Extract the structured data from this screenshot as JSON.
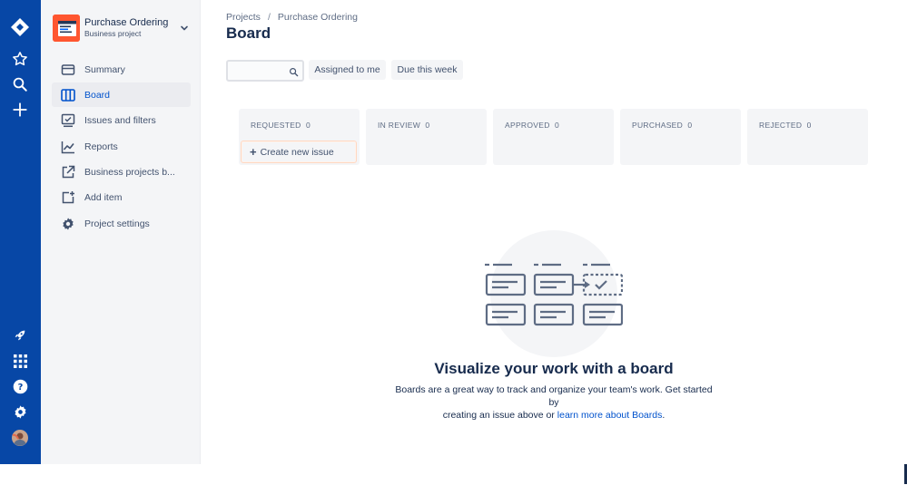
{
  "global_nav": {
    "icons": [
      "jira-logo-icon",
      "star-icon",
      "search-icon",
      "plus-icon",
      "rocket-icon",
      "app-switcher-icon",
      "help-icon",
      "settings-icon",
      "avatar"
    ]
  },
  "project": {
    "name": "Purchase Ordering",
    "type": "Business project"
  },
  "sidebar": {
    "items": [
      {
        "label": "Summary",
        "icon": "summary-icon",
        "active": false
      },
      {
        "label": "Board",
        "icon": "board-icon",
        "active": true
      },
      {
        "label": "Issues and filters",
        "icon": "issues-icon",
        "active": false
      },
      {
        "label": "Reports",
        "icon": "reports-icon",
        "active": false
      },
      {
        "label": "Business projects b...",
        "icon": "external-link-icon",
        "active": false
      },
      {
        "label": "Add item",
        "icon": "add-item-icon",
        "active": false
      },
      {
        "label": "Project settings",
        "icon": "gear-icon",
        "active": false
      }
    ]
  },
  "breadcrumb": {
    "root": "Projects",
    "separator": "/",
    "current": "Purchase Ordering"
  },
  "page": {
    "title": "Board"
  },
  "filters": {
    "search_placeholder": "",
    "assigned_to_me": "Assigned to me",
    "due_this_week": "Due this week"
  },
  "columns": [
    {
      "title": "REQUESTED",
      "count": "0"
    },
    {
      "title": "IN REVIEW",
      "count": "0"
    },
    {
      "title": "APPROVED",
      "count": "0"
    },
    {
      "title": "PURCHASED",
      "count": "0"
    },
    {
      "title": "REJECTED",
      "count": "0"
    }
  ],
  "create_issue": {
    "label": "Create new issue"
  },
  "empty_state": {
    "title": "Visualize your work with a board",
    "desc_line1": "Boards are a great way to track and organize your team's work. Get started by",
    "desc_line2_prefix": "creating an issue above or ",
    "learn_more_link": "learn more about Boards",
    "desc_line2_suffix": "."
  },
  "colors": {
    "nav_bg": "#0747a6",
    "sidebar_bg": "#f4f5f7",
    "accent": "#0052cc",
    "project_avatar": "#ff5630"
  }
}
